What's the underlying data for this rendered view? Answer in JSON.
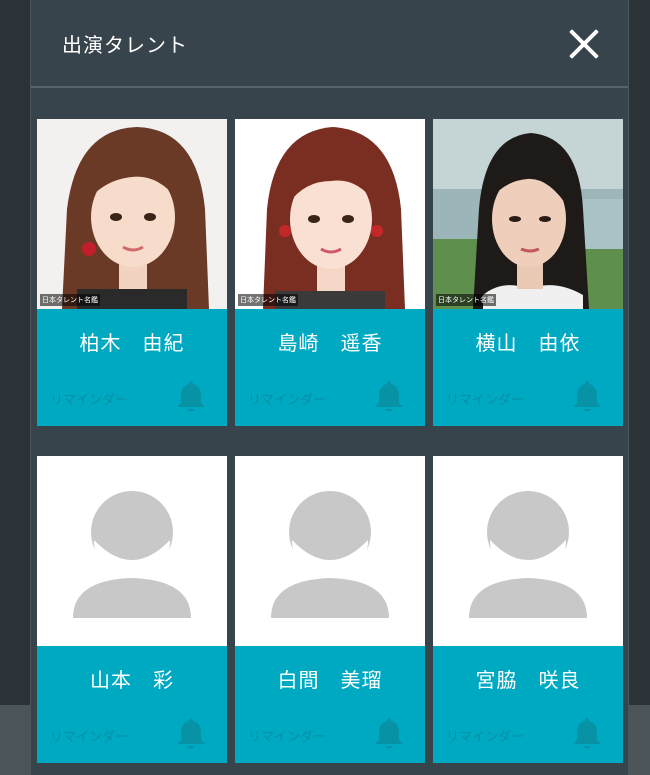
{
  "modal": {
    "title": "出演タレント",
    "close_icon": "close-icon"
  },
  "talents": [
    {
      "name": "柏木　由紀",
      "reminder": "リマインダー",
      "has_photo": true,
      "watermark": "日本タレント名鑑"
    },
    {
      "name": "島崎　遥香",
      "reminder": "リマインダー",
      "has_photo": true,
      "watermark": "日本タレント名鑑"
    },
    {
      "name": "横山　由依",
      "reminder": "リマインダー",
      "has_photo": true,
      "watermark": "日本タレント名鑑"
    },
    {
      "name": "山本　彩",
      "reminder": "リマインダー",
      "has_photo": false
    },
    {
      "name": "白間　美瑠",
      "reminder": "リマインダー",
      "has_photo": false
    },
    {
      "name": "宮脇　咲良",
      "reminder": "リマインダー",
      "has_photo": false
    }
  ],
  "colors": {
    "backdrop": "#2b3338",
    "modal": "#38444b",
    "card_band": "#00a9c2",
    "reminder_text": "#0890a5",
    "placeholder_avatar": "#c8c8c8"
  }
}
